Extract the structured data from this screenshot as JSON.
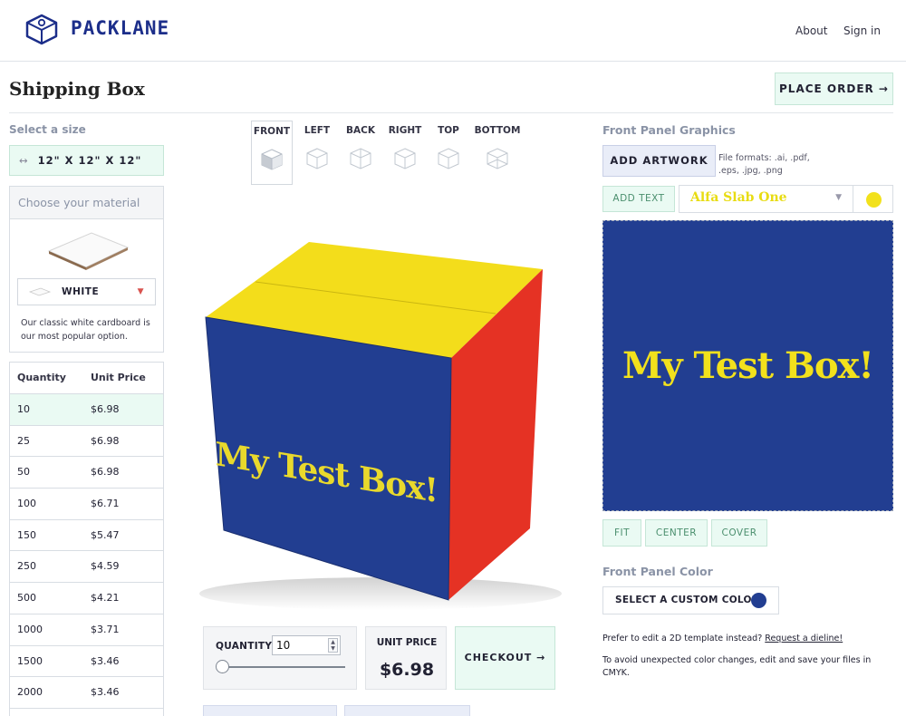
{
  "header": {
    "brand": "PACKLANE",
    "nav": [
      "About",
      "Sign in"
    ]
  },
  "page": {
    "title": "Shipping Box",
    "place_order": "PLACE ORDER →"
  },
  "size": {
    "label": "Select a size",
    "value": "12\" X 12\" X 12\""
  },
  "material": {
    "heading": "Choose your material",
    "selected": "WHITE",
    "description": "Our classic white cardboard is our most popular option."
  },
  "pricing": {
    "headers": [
      "Quantity",
      "Unit Price"
    ],
    "rows": [
      {
        "q": "10",
        "p": "$6.98"
      },
      {
        "q": "25",
        "p": "$6.98"
      },
      {
        "q": "50",
        "p": "$6.98"
      },
      {
        "q": "100",
        "p": "$6.71"
      },
      {
        "q": "150",
        "p": "$5.47"
      },
      {
        "q": "250",
        "p": "$4.59"
      },
      {
        "q": "500",
        "p": "$4.21"
      },
      {
        "q": "1000",
        "p": "$3.71"
      },
      {
        "q": "1500",
        "p": "$3.46"
      },
      {
        "q": "2000",
        "p": "$3.46"
      }
    ]
  },
  "views": [
    "FRONT",
    "LEFT",
    "BACK",
    "RIGHT",
    "TOP",
    "BOTTOM"
  ],
  "box": {
    "text": "My Test Box!",
    "colors": {
      "front": "#223e91",
      "top": "#f3dd1b",
      "side": "#e53224",
      "text": "#e9d92c"
    }
  },
  "order": {
    "quantity_label": "QUANTITY",
    "quantity_value": "10",
    "unit_price_label": "UNIT PRICE",
    "unit_price": "$6.98",
    "checkout": "CHECKOUT →"
  },
  "graphics": {
    "heading": "Front Panel Graphics",
    "add_artwork": "ADD ARTWORK",
    "file_formats": "File formats: .ai, .pdf, .eps, .jpg, .png",
    "add_text": "ADD TEXT",
    "font": "Alfa Slab One",
    "text_color": "#f2e11c",
    "canvas_text": "My Test Box!",
    "canvas_bg": "#223e91",
    "fit_buttons": [
      "FIT",
      "CENTER",
      "COVER"
    ]
  },
  "panel_color": {
    "heading": "Front Panel Color",
    "button": "SELECT A CUSTOM COLOR",
    "color": "#223e91"
  },
  "notes": {
    "template_prefix": "Prefer to edit a 2D template instead?",
    "template_link": "Request a dieline!",
    "cmyk": "To avoid unexpected color changes, edit and save your files in CMYK."
  }
}
